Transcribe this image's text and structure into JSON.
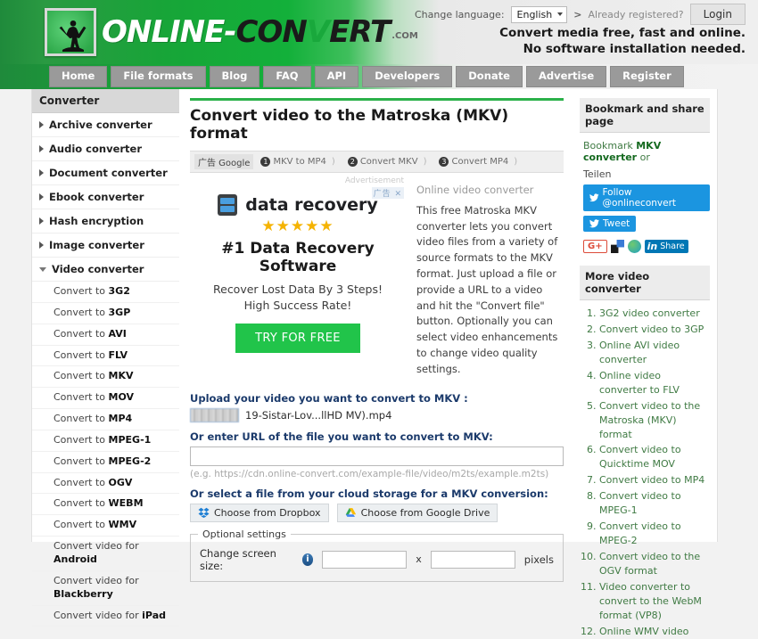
{
  "header": {
    "logo_text_parts": [
      "ONLINE-",
      "CON",
      "V",
      "ERT"
    ],
    "logo_part_white": "ONLINE-",
    "logo_part_dark1": "CON",
    "logo_part_green": "V",
    "logo_part_dark2": "ERT",
    "logo_com": ".COM",
    "logo_icon": "person-silhouette-icon",
    "change_language_label": "Change language:",
    "language_value": "English",
    "language_arrow": ">",
    "already_registered": "Already registered?",
    "login_label": "Login",
    "tagline_line1": "Convert media free, fast and online.",
    "tagline_line2": "No software installation needed."
  },
  "nav": {
    "items": [
      {
        "label": "Home",
        "active": false
      },
      {
        "label": "File formats",
        "active": true
      },
      {
        "label": "Blog",
        "active": false
      },
      {
        "label": "FAQ",
        "active": false
      },
      {
        "label": "API",
        "active": false
      },
      {
        "label": "Developers",
        "active": false
      },
      {
        "label": "Donate",
        "active": false
      },
      {
        "label": "Advertise",
        "active": false
      },
      {
        "label": "Register",
        "active": false
      }
    ]
  },
  "sidebar": {
    "title": "Converter",
    "categories": [
      {
        "label": "Archive converter",
        "expanded": false
      },
      {
        "label": "Audio converter",
        "expanded": false
      },
      {
        "label": "Document converter",
        "expanded": false
      },
      {
        "label": "Ebook converter",
        "expanded": false
      },
      {
        "label": "Hash encryption",
        "expanded": false
      },
      {
        "label": "Image converter",
        "expanded": false
      },
      {
        "label": "Video converter",
        "expanded": true
      }
    ],
    "video_items": [
      {
        "prefix": "Convert to ",
        "format": "3G2"
      },
      {
        "prefix": "Convert to ",
        "format": "3GP"
      },
      {
        "prefix": "Convert to ",
        "format": "AVI"
      },
      {
        "prefix": "Convert to ",
        "format": "FLV"
      },
      {
        "prefix": "Convert to ",
        "format": "MKV"
      },
      {
        "prefix": "Convert to ",
        "format": "MOV"
      },
      {
        "prefix": "Convert to ",
        "format": "MP4"
      },
      {
        "prefix": "Convert to ",
        "format": "MPEG-1"
      },
      {
        "prefix": "Convert to ",
        "format": "MPEG-2"
      },
      {
        "prefix": "Convert to ",
        "format": "OGV"
      },
      {
        "prefix": "Convert to ",
        "format": "WEBM"
      },
      {
        "prefix": "Convert to ",
        "format": "WMV"
      },
      {
        "prefix": "Convert video for ",
        "format": "Android"
      },
      {
        "prefix": "Convert video for ",
        "format": "Blackberry"
      },
      {
        "prefix": "Convert video for ",
        "format": "iPad"
      }
    ]
  },
  "main": {
    "page_title": "Convert video to the Matroska (MKV) format",
    "adbar": {
      "google_tag": "广告 Google",
      "links": [
        {
          "num": "1",
          "label": "MKV to MP4"
        },
        {
          "num": "2",
          "label": "Convert MKV"
        },
        {
          "num": "3",
          "label": "Convert MP4"
        }
      ]
    },
    "ad": {
      "advertisement_label": "Advertisement",
      "close_label": "广告 ✕",
      "brand": "data recovery",
      "brand_icon": "server-stack-icon",
      "stars": "★★★★★",
      "headline": "#1 Data Recovery Software",
      "sub_line1": "Recover Lost Data By 3 Steps!",
      "sub_line2": "High Success Rate!",
      "cta": "TRY FOR FREE"
    },
    "description": {
      "title": "Online video converter",
      "body": "This free Matroska MKV converter lets you convert video files from a variety of source formats to the MKV format. Just upload a file or provide a URL to a video and hit the \"Convert file\" button. Optionally you can select video enhancements to change video quality settings."
    },
    "form": {
      "upload_label": "Upload your video you want to convert to MKV :",
      "file_name": "19-Sistar-Lov...llHD MV).mp4",
      "url_label": "Or enter URL of the file you want to convert to MKV:",
      "url_value": "",
      "url_placeholder": "",
      "url_hint": "(e.g. https://cdn.online-convert.com/example-file/video/m2ts/example.m2ts)",
      "cloud_label": "Or select a file from your cloud storage for a MKV conversion:",
      "dropbox_label": "Choose from Dropbox",
      "gdrive_label": "Choose from Google Drive",
      "settings_legend": "Optional settings",
      "screen_size_label": "Change screen size:",
      "info_icon": "info-icon",
      "width_value": "",
      "height_value": "",
      "x_separator": "x",
      "pixels_label": "pixels"
    }
  },
  "right": {
    "bookmark_head": "Bookmark and share page",
    "bookmark_prefix": "Bookmark ",
    "bookmark_link": "MKV converter",
    "bookmark_suffix": " or",
    "teilen": "Teilen",
    "follow_label": "Follow @onlineconvert",
    "tweet_label": "Tweet",
    "gplus_label": "G+",
    "linkedin_label": "Share",
    "more_head": "More video converter",
    "more_items": [
      "3G2 video converter",
      "Convert video to 3GP",
      "Online AVI video converter",
      "Online video converter to FLV",
      "Convert video to the Matroska (MKV) format",
      "Convert video to Quicktime MOV",
      "Convert video to MP4",
      "Convert video to MPEG-1",
      "Convert video to MPEG-2",
      "Convert video to the OGV format",
      "Video converter to convert to the WebM format (VP8)",
      "Online WMV video"
    ]
  }
}
